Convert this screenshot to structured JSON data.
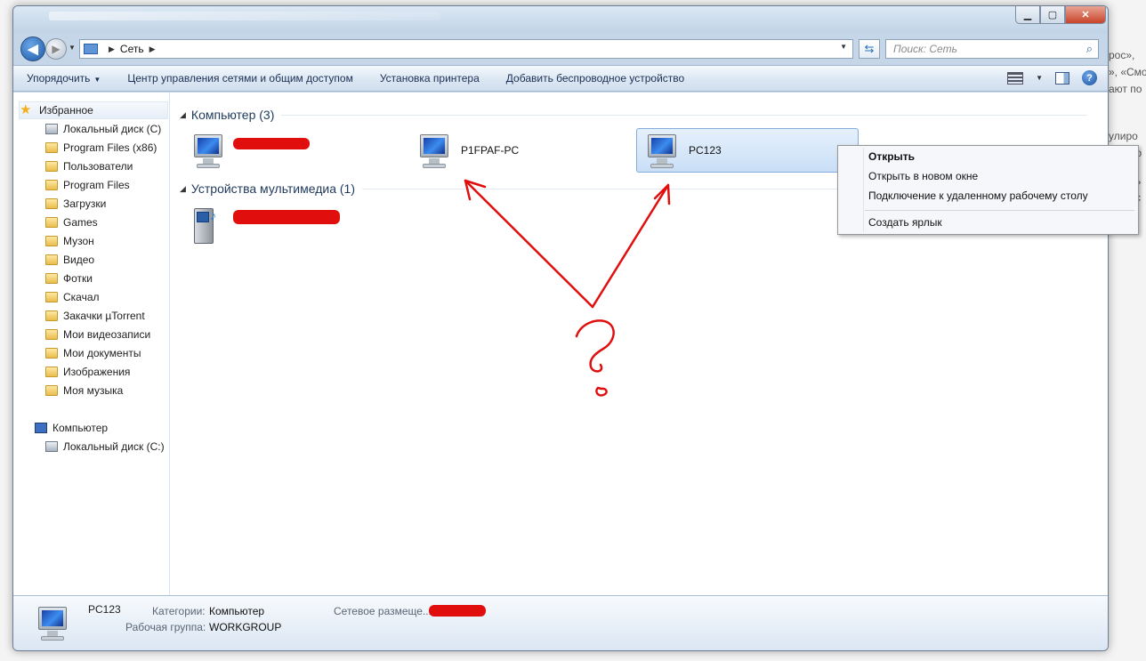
{
  "background": {
    "fragments": [
      "рос»,",
      "», «Смо",
      "ают по",
      "улиро",
      "по",
      "ь",
      "с"
    ]
  },
  "window": {
    "caption": {
      "minimize": "▁",
      "maximize": "▢",
      "close": "✕"
    }
  },
  "navigation": {
    "back_glyph": "◀",
    "forward_glyph": "▶",
    "address": {
      "breadcrumbs": [
        "Сеть"
      ]
    },
    "search": {
      "placeholder": "Поиск: Сеть"
    }
  },
  "toolbar": {
    "organize": "Упорядочить",
    "items": [
      "Центр управления сетями и общим доступом",
      "Установка принтера",
      "Добавить беспроводное устройство"
    ]
  },
  "sidebar": {
    "favorites_label": "Избранное",
    "favorites": [
      "Локальный диск (C)",
      "Program Files (x86)",
      "Пользователи",
      "Program Files",
      "Загрузки",
      "Games",
      "Музон",
      "Видео",
      "Фотки",
      "Скачал",
      "Закачки  µTorrent",
      "Мои видеозаписи",
      "Мои документы",
      "Изображения",
      "Моя музыка"
    ],
    "computer_label": "Компьютер",
    "computer_items": [
      "Локальный диск (C:)"
    ]
  },
  "main": {
    "groups": [
      {
        "title": "Компьютер (3)",
        "items": [
          "",
          "P1FPAF-PC",
          "PC123"
        ]
      },
      {
        "title": "Устройства мультимедиа (1)",
        "items": [
          ""
        ]
      }
    ],
    "selected_item": "PC123"
  },
  "context_menu": {
    "items": [
      "Открыть",
      "Открыть в новом окне",
      "Подключение к удаленному рабочему столу",
      "Создать ярлык"
    ]
  },
  "details": {
    "name": "PC123",
    "category_label": "Категории:",
    "category_value": "Компьютер",
    "workgroup_label": "Рабочая группа:",
    "workgroup_value": "WORKGROUP",
    "location_label": "Сетевое размеще..."
  },
  "annotation": {
    "color": "#e10e0e"
  }
}
